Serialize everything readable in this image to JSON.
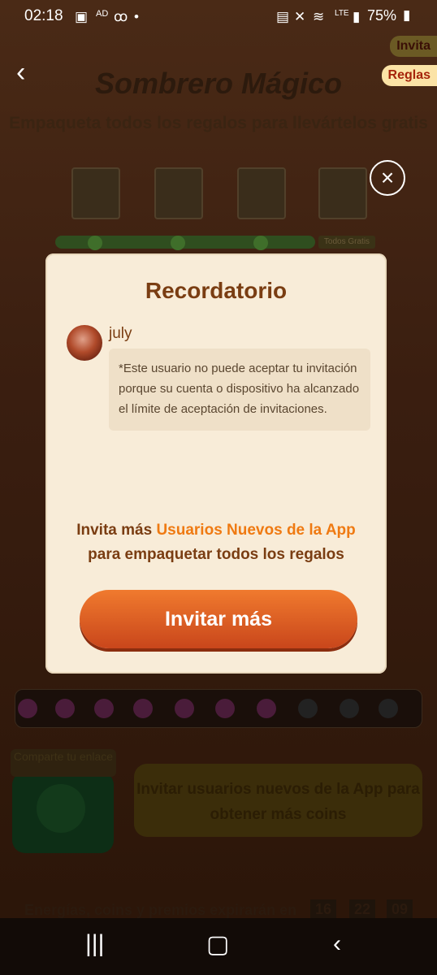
{
  "status_bar": {
    "time": "02:18",
    "battery": "75%"
  },
  "background": {
    "title": "Sombrero Mágico",
    "subtitle": "Empaqueta todos los regalos para llevártelos gratis",
    "invita_pill": "Invita",
    "reglas_pill": "Reglas",
    "todos_gratis": "Todos Gratis",
    "share_label": "Comparte tu enlace",
    "invite_button": "Invitar usuarios nuevos de la App para obtener más coins",
    "expire_text": "Energías, coins y premios expirarán en",
    "timer": {
      "h": "16",
      "m": "22",
      "s": "09"
    }
  },
  "modal": {
    "title": "Recordatorio",
    "username": "july",
    "message": "*Este usuario no puede aceptar tu invitación porque su cuenta o dispositivo ha alcanzado el límite de aceptación de invitaciones.",
    "invite_prefix": "Invita más ",
    "invite_highlight": "Usuarios Nuevos de la App",
    "invite_suffix": "para empaquetar todos los regalos",
    "cta_label": "Invitar más"
  },
  "icons": {
    "back": "chevron-left-icon",
    "close": "close-icon",
    "share": "whatsapp-icon"
  }
}
